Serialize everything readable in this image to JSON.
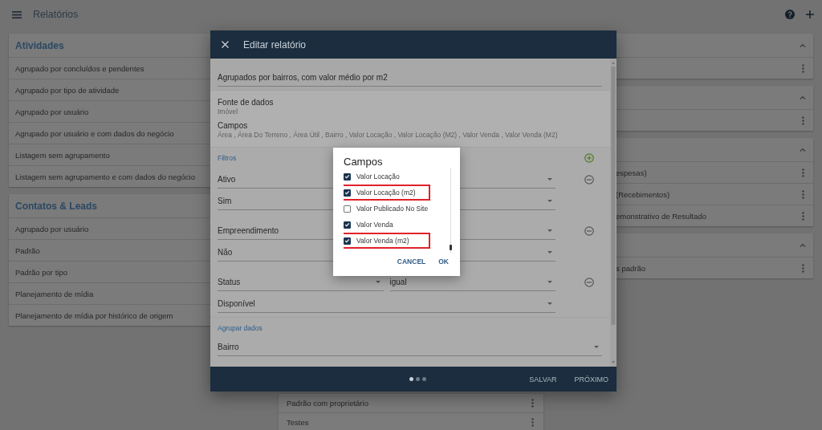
{
  "top_bar": {
    "title": "Relatórios"
  },
  "left_cards": [
    {
      "title": "Atividades",
      "items": [
        "Agrupado por concluídos e pendentes",
        "Agrupado por tipo de atividade",
        "Agrupado por usuário",
        "Agrupado por usuário e com dados do negócio",
        "Listagem sem agrupamento",
        "Listagem sem agrupamento e com dados do negócio"
      ]
    },
    {
      "title": "Contatos & Leads",
      "items": [
        "Agrupado por usuário",
        "Padrão",
        "Padrão por tipo",
        "Planejamento de mídia",
        "Planejamento de mídia por histórico de origem"
      ]
    }
  ],
  "middle_card": {
    "items": [
      "Padrão com proprietário",
      "Testes"
    ]
  },
  "right_cards": [
    {
      "expanded": true
    },
    {
      "expanded": true
    },
    {
      "expanded": true,
      "items": [
        "espesas)",
        "(Recebimentos)",
        "emonstrativo de Resultado"
      ]
    },
    {
      "expanded": true,
      "items": [
        "s padrão"
      ]
    }
  ],
  "modal": {
    "title": "Editar relatório",
    "name_value": "Agrupados por bairros, com valor médio por m2",
    "data_source": {
      "label": "Fonte de dados",
      "value": "Imóvel"
    },
    "fields": {
      "label": "Campos",
      "value": "Área , Área Do Terreno , Área Útil , Bairro , Valor Locação , Valor Locação (M2) , Valor Venda , Valor Venda (M2)"
    },
    "filters": {
      "title": "Filtros",
      "groups": [
        {
          "field": "Ativo",
          "value": "Sim"
        },
        {
          "field": "Empreendimento",
          "value": "Não"
        },
        {
          "field": "Status",
          "operator": "igual",
          "value": "Disponível"
        }
      ]
    },
    "group_by": {
      "title": "Agrupar dados",
      "value": "Bairro"
    },
    "steps": [
      {
        "selected": true
      },
      {
        "selected": false
      },
      {
        "selected": false
      }
    ],
    "buttons": [
      "SALVAR",
      "PRÓXIMO"
    ]
  },
  "dialog": {
    "title": "Campos",
    "options": [
      {
        "label": "Valor Locação",
        "checked": true,
        "highlighted": false
      },
      {
        "label": "Valor Locação (m2)",
        "checked": true,
        "highlighted": true
      },
      {
        "label": "Valor Publicado No Site",
        "checked": false,
        "highlighted": false
      },
      {
        "label": "Valor Venda",
        "checked": true,
        "highlighted": false
      },
      {
        "label": "Valor Venda (m2)",
        "checked": true,
        "highlighted": true
      }
    ],
    "buttons": [
      "CANCEL",
      "OK"
    ]
  }
}
